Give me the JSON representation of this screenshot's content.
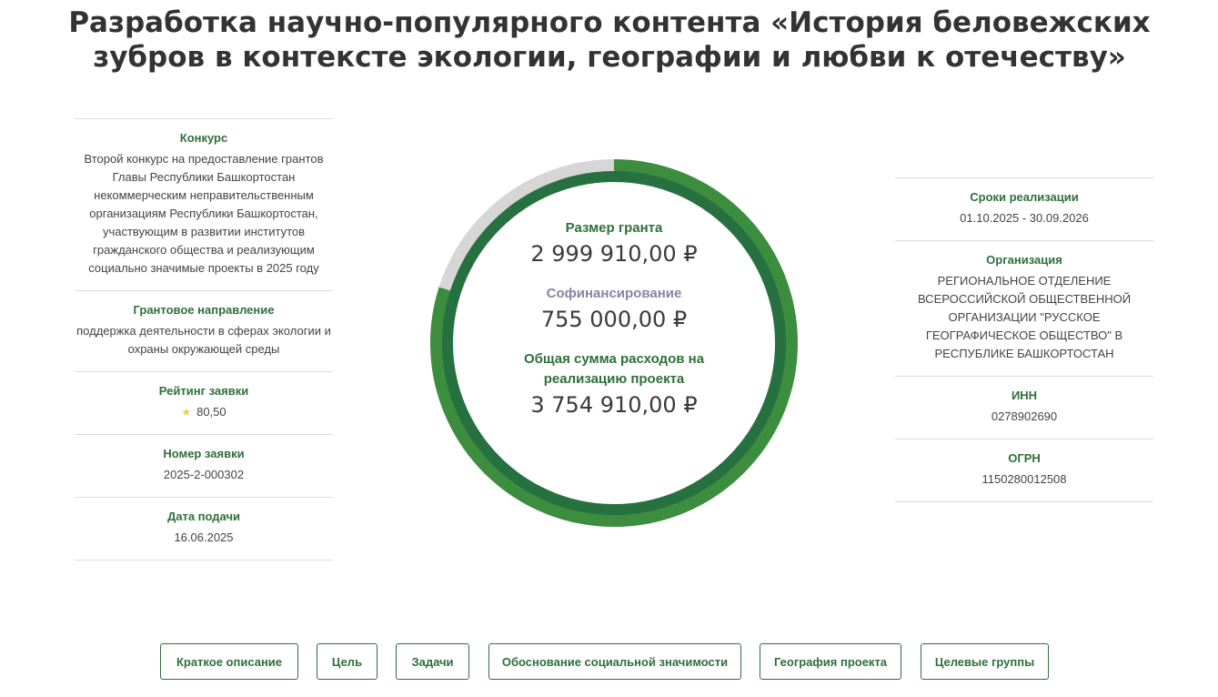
{
  "title": "Разработка научно-популярного контента «История беловежских зубров в контексте экологии, географии и любви к отечеству»",
  "left": [
    {
      "label": "Конкурс",
      "value": "Второй конкурс на предоставление грантов Главы Республики Башкортостан некоммерческим неправительственным организациям Республики Башкортостан, участвующим в развитии институтов гражданского общества и реализующим социально значимые проекты в 2025 году"
    },
    {
      "label": "Грантовое направление",
      "value": "поддержка деятельности в сферах экологии и охраны окружающей среды"
    },
    {
      "label": "Рейтинг заявки",
      "value": "80,50"
    },
    {
      "label": "Номер заявки",
      "value": "2025-2-000302"
    },
    {
      "label": "Дата подачи",
      "value": "16.06.2025"
    }
  ],
  "right": [
    {
      "label": "Сроки реализации",
      "value": "01.10.2025 - 30.09.2026"
    },
    {
      "label": "Организация",
      "value": "РЕГИОНАЛЬНОЕ ОТДЕЛЕНИЕ ВСЕРОССИЙСКОЙ ОБЩЕСТВЕННОЙ ОРГАНИЗАЦИИ \"РУССКОЕ ГЕОГРАФИЧЕСКОЕ ОБЩЕСТВО\" В РЕСПУБЛИКЕ БАШКОРТОСТАН"
    },
    {
      "label": "ИНН",
      "value": "0278902690"
    },
    {
      "label": "ОГРН",
      "value": "1150280012508"
    }
  ],
  "center": {
    "grant_label": "Размер гранта",
    "grant_amount": "2 999 910,00 ₽",
    "cofin_label": "Софинансирование",
    "cofin_amount": "755 000,00 ₽",
    "total_label": "Общая сумма расходов на реализацию проекта",
    "total_amount": "3 754 910,00 ₽"
  },
  "ring": {
    "grant_share": 0.799,
    "color_grant": "#3d8d3f",
    "color_inner": "#27703f",
    "color_rest": "#d6d6d6"
  },
  "icons": {
    "rating": "star-icon"
  },
  "tabs": [
    "Краткое описание",
    "Цель",
    "Задачи",
    "Обоснование социальной значимости",
    "География проекта",
    "Целевые группы"
  ]
}
